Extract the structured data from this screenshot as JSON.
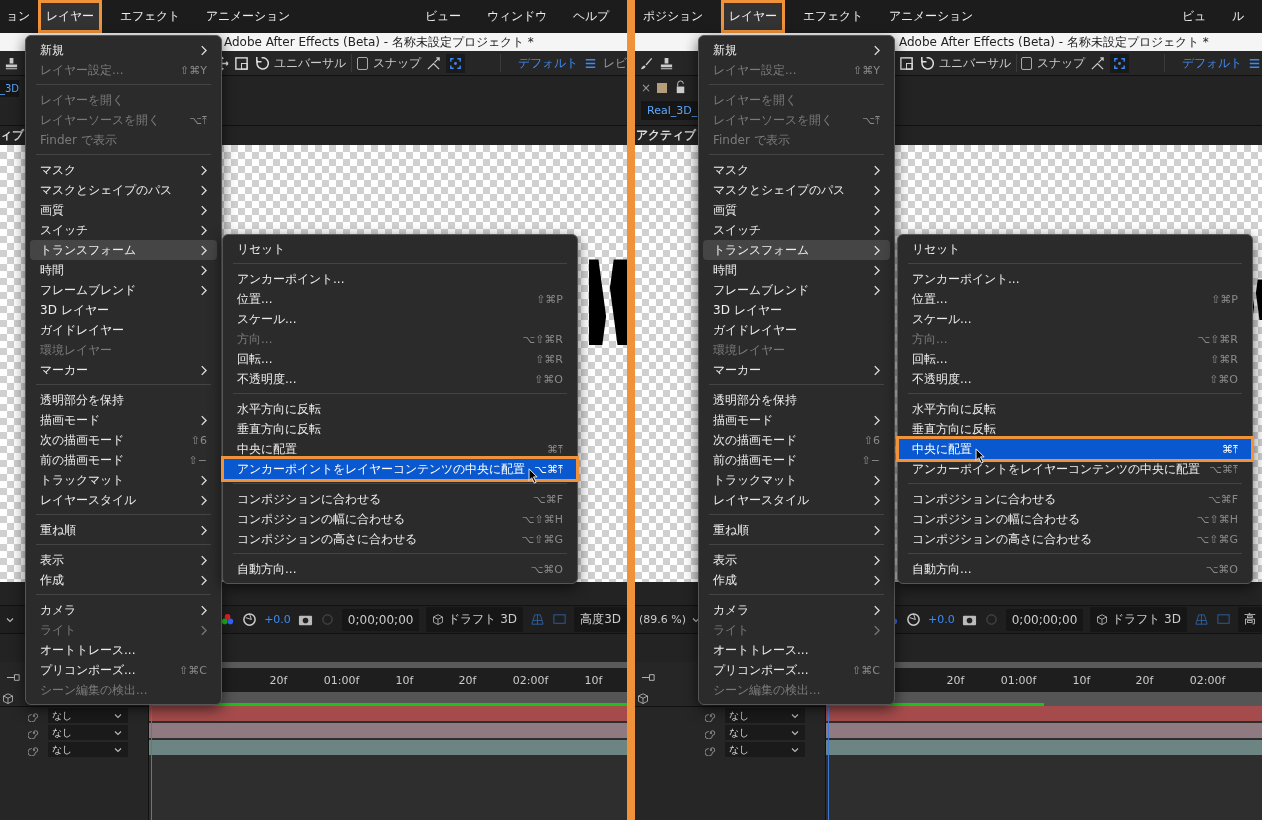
{
  "panels": [
    {
      "menubar": [
        {
          "label": "ョン",
          "selected": false
        },
        {
          "label": "レイヤー",
          "selected": true
        },
        {
          "label": "エフェクト",
          "selected": false
        },
        {
          "label": "アニメーション",
          "selected": false
        }
      ],
      "menubar_right": [
        {
          "label": "ビュー",
          "selected": false
        },
        {
          "label": "ウィンドウ",
          "selected": false
        },
        {
          "label": "ヘルプ",
          "selected": false
        }
      ],
      "title": "Adobe After Effects (Beta) - 名称未設定プロジェクト *",
      "toolbar": {
        "mode": "ユニバーサル",
        "snap": "スナップ",
        "snap_checked": false,
        "workspace": "デフォルト",
        "extra": "レビ"
      },
      "comp_tab": "_3D",
      "viewer_label": "ィブ",
      "viewer_bar": {
        "exposure": "+0.0",
        "timecode": "0;00;00;00",
        "renderer": "ドラフト 3D",
        "extra": "高度3D"
      },
      "ruler": [
        "20f",
        "01:00f",
        "10f",
        "20f",
        "02:00f",
        "10f"
      ],
      "work_area": {
        "level": 1
      },
      "layers": [
        {
          "parent": "なし",
          "color": "#a54b4b"
        },
        {
          "parent": "なし",
          "color": "#8e7a80"
        },
        {
          "parent": "なし",
          "color": "#6c8582"
        }
      ],
      "layer_menu": [
        {
          "kind": "item",
          "label": "新規",
          "submenu": true,
          "disabled": false,
          "selected": false
        },
        {
          "kind": "item",
          "label": "レイヤー設定...",
          "shortcut": "⇧⌘Y",
          "submenu": false,
          "disabled": true,
          "selected": false
        },
        {
          "kind": "separator"
        },
        {
          "kind": "item",
          "label": "レイヤーを開く",
          "submenu": false,
          "disabled": true,
          "selected": false
        },
        {
          "kind": "item",
          "label": "レイヤーソースを開く",
          "shortcut": "⌥⤒",
          "submenu": false,
          "disabled": true,
          "selected": false
        },
        {
          "kind": "item",
          "label": "Finder で表示",
          "submenu": false,
          "disabled": true,
          "selected": false
        },
        {
          "kind": "separator"
        },
        {
          "kind": "item",
          "label": "マスク",
          "submenu": true,
          "disabled": false,
          "selected": false
        },
        {
          "kind": "item",
          "label": "マスクとシェイプのパス",
          "submenu": true,
          "disabled": false,
          "selected": false
        },
        {
          "kind": "item",
          "label": "画質",
          "submenu": true,
          "disabled": false,
          "selected": false
        },
        {
          "kind": "item",
          "label": "スイッチ",
          "submenu": true,
          "disabled": false,
          "selected": false
        },
        {
          "kind": "item",
          "label": "トランスフォーム",
          "submenu": true,
          "disabled": false,
          "selected": true
        },
        {
          "kind": "item",
          "label": "時間",
          "submenu": true,
          "disabled": false,
          "selected": false
        },
        {
          "kind": "item",
          "label": "フレームブレンド",
          "submenu": true,
          "disabled": false,
          "selected": false
        },
        {
          "kind": "item",
          "label": "3D レイヤー",
          "submenu": false,
          "disabled": false,
          "selected": false
        },
        {
          "kind": "item",
          "label": "ガイドレイヤー",
          "submenu": false,
          "disabled": false,
          "selected": false
        },
        {
          "kind": "item",
          "label": "環境レイヤー",
          "submenu": false,
          "disabled": true,
          "selected": false
        },
        {
          "kind": "item",
          "label": "マーカー",
          "submenu": true,
          "disabled": false,
          "selected": false
        },
        {
          "kind": "separator"
        },
        {
          "kind": "item",
          "label": "透明部分を保持",
          "submenu": false,
          "disabled": false,
          "selected": false
        },
        {
          "kind": "item",
          "label": "描画モード",
          "submenu": true,
          "disabled": false,
          "selected": false
        },
        {
          "kind": "item",
          "label": "次の描画モード",
          "shortcut": "⇧6",
          "submenu": false,
          "disabled": false,
          "selected": false
        },
        {
          "kind": "item",
          "label": "前の描画モード",
          "shortcut": "⇧−",
          "submenu": false,
          "disabled": false,
          "selected": false
        },
        {
          "kind": "item",
          "label": "トラックマット",
          "submenu": true,
          "disabled": false,
          "selected": false
        },
        {
          "kind": "item",
          "label": "レイヤースタイル",
          "submenu": true,
          "disabled": false,
          "selected": false
        },
        {
          "kind": "separator"
        },
        {
          "kind": "item",
          "label": "重ね順",
          "submenu": true,
          "disabled": false,
          "selected": false
        },
        {
          "kind": "separator"
        },
        {
          "kind": "item",
          "label": "表示",
          "submenu": true,
          "disabled": false,
          "selected": false
        },
        {
          "kind": "item",
          "label": "作成",
          "submenu": true,
          "disabled": false,
          "selected": false
        },
        {
          "kind": "separator"
        },
        {
          "kind": "item",
          "label": "カメラ",
          "submenu": true,
          "disabled": false,
          "selected": false
        },
        {
          "kind": "item",
          "label": "ライト",
          "submenu": true,
          "disabled": true,
          "selected": false
        },
        {
          "kind": "item",
          "label": "オートトレース...",
          "submenu": false,
          "disabled": false,
          "selected": false
        },
        {
          "kind": "item",
          "label": "プリコンポーズ...",
          "shortcut": "⇧⌘C",
          "submenu": false,
          "disabled": false,
          "selected": false
        },
        {
          "kind": "item",
          "label": "シーン編集の検出...",
          "submenu": false,
          "disabled": true,
          "selected": false
        }
      ],
      "transform_menu": [
        {
          "kind": "item",
          "label": "リセット",
          "disabled": false,
          "selected": false,
          "hovered": false
        },
        {
          "kind": "separator"
        },
        {
          "kind": "item",
          "label": "アンカーポイント...",
          "disabled": false,
          "selected": false,
          "hovered": false
        },
        {
          "kind": "item",
          "label": "位置...",
          "shortcut": "⇧⌘P",
          "disabled": false,
          "selected": false,
          "hovered": false
        },
        {
          "kind": "item",
          "label": "スケール...",
          "disabled": false,
          "selected": false,
          "hovered": false
        },
        {
          "kind": "item",
          "label": "方向...",
          "shortcut": "⌥⇧⌘R",
          "disabled": true,
          "selected": false,
          "hovered": false
        },
        {
          "kind": "item",
          "label": "回転...",
          "shortcut": "⇧⌘R",
          "disabled": false,
          "selected": false,
          "hovered": false
        },
        {
          "kind": "item",
          "label": "不透明度...",
          "shortcut": "⇧⌘O",
          "disabled": false,
          "selected": false,
          "hovered": false
        },
        {
          "kind": "separator"
        },
        {
          "kind": "item",
          "label": "水平方向に反転",
          "disabled": false,
          "selected": false,
          "hovered": false
        },
        {
          "kind": "item",
          "label": "垂直方向に反転",
          "disabled": false,
          "selected": false,
          "hovered": false
        },
        {
          "kind": "item",
          "label": "中央に配置",
          "shortcut": "⌘⤒",
          "disabled": false,
          "selected": false,
          "hovered": false
        },
        {
          "kind": "item",
          "label": "アンカーポイントをレイヤーコンテンツの中央に配置",
          "shortcut": "⌥⌘⤒",
          "disabled": false,
          "selected": true,
          "hovered": true
        },
        {
          "kind": "separator"
        },
        {
          "kind": "item",
          "label": "コンポジションに合わせる",
          "shortcut": "⌥⌘F",
          "disabled": false,
          "selected": false,
          "hovered": false
        },
        {
          "kind": "item",
          "label": "コンポジションの幅に合わせる",
          "shortcut": "⌥⇧⌘H",
          "disabled": false,
          "selected": false,
          "hovered": false
        },
        {
          "kind": "item",
          "label": "コンポジションの高さに合わせる",
          "shortcut": "⌥⇧⌘G",
          "disabled": false,
          "selected": false,
          "hovered": false
        },
        {
          "kind": "separator"
        },
        {
          "kind": "item",
          "label": "自動方向...",
          "shortcut": "⌥⌘O",
          "disabled": false,
          "selected": false,
          "hovered": false
        }
      ]
    },
    {
      "menubar": [
        {
          "label": "ポジション",
          "selected": false
        },
        {
          "label": "レイヤー",
          "selected": true
        },
        {
          "label": "エフェクト",
          "selected": false
        },
        {
          "label": "アニメーション",
          "selected": false
        }
      ],
      "menubar_right": [
        {
          "label": "ビュ",
          "selected": false
        },
        {
          "label": "ル",
          "selected": false
        }
      ],
      "title": "Adobe After Effects (Beta) - 名称未設定プロジェクト *",
      "toolbar": {
        "mode": "ユニバーサル",
        "snap": "スナップ",
        "snap_checked": false,
        "workspace": "デフォルト"
      },
      "tab_close": "×",
      "comp_tab": "Real_3D_",
      "viewer_label": "アクティブ",
      "viewer_bar": {
        "zoom": "(89.6 %)",
        "exposure": "+0.0",
        "timecode": "0;00;00;00",
        "renderer": "ドラフト 3D",
        "extra": "高"
      },
      "ruler": [
        "20f",
        "01:00f",
        "10f",
        "20f",
        "02:00f"
      ],
      "work_area": {
        "level": 0.5
      },
      "layers": [
        {
          "parent": "なし",
          "color": "#a54b4b"
        },
        {
          "parent": "なし",
          "color": "#8e7a80"
        },
        {
          "parent": "なし",
          "color": "#6c8582"
        }
      ],
      "layer_menu": [
        {
          "kind": "item",
          "label": "新規",
          "submenu": true,
          "disabled": false,
          "selected": false
        },
        {
          "kind": "item",
          "label": "レイヤー設定...",
          "shortcut": "⇧⌘Y",
          "submenu": false,
          "disabled": true,
          "selected": false
        },
        {
          "kind": "separator"
        },
        {
          "kind": "item",
          "label": "レイヤーを開く",
          "submenu": false,
          "disabled": true,
          "selected": false
        },
        {
          "kind": "item",
          "label": "レイヤーソースを開く",
          "shortcut": "⌥⤒",
          "submenu": false,
          "disabled": true,
          "selected": false
        },
        {
          "kind": "item",
          "label": "Finder で表示",
          "submenu": false,
          "disabled": true,
          "selected": false
        },
        {
          "kind": "separator"
        },
        {
          "kind": "item",
          "label": "マスク",
          "submenu": true,
          "disabled": false,
          "selected": false
        },
        {
          "kind": "item",
          "label": "マスクとシェイプのパス",
          "submenu": true,
          "disabled": false,
          "selected": false
        },
        {
          "kind": "item",
          "label": "画質",
          "submenu": true,
          "disabled": false,
          "selected": false
        },
        {
          "kind": "item",
          "label": "スイッチ",
          "submenu": true,
          "disabled": false,
          "selected": false
        },
        {
          "kind": "item",
          "label": "トランスフォーム",
          "submenu": true,
          "disabled": false,
          "selected": true
        },
        {
          "kind": "item",
          "label": "時間",
          "submenu": true,
          "disabled": false,
          "selected": false
        },
        {
          "kind": "item",
          "label": "フレームブレンド",
          "submenu": true,
          "disabled": false,
          "selected": false
        },
        {
          "kind": "item",
          "label": "3D レイヤー",
          "submenu": false,
          "disabled": false,
          "selected": false
        },
        {
          "kind": "item",
          "label": "ガイドレイヤー",
          "submenu": false,
          "disabled": false,
          "selected": false
        },
        {
          "kind": "item",
          "label": "環境レイヤー",
          "submenu": false,
          "disabled": true,
          "selected": false
        },
        {
          "kind": "item",
          "label": "マーカー",
          "submenu": true,
          "disabled": false,
          "selected": false
        },
        {
          "kind": "separator"
        },
        {
          "kind": "item",
          "label": "透明部分を保持",
          "submenu": false,
          "disabled": false,
          "selected": false
        },
        {
          "kind": "item",
          "label": "描画モード",
          "submenu": true,
          "disabled": false,
          "selected": false
        },
        {
          "kind": "item",
          "label": "次の描画モード",
          "shortcut": "⇧6",
          "submenu": false,
          "disabled": false,
          "selected": false
        },
        {
          "kind": "item",
          "label": "前の描画モード",
          "shortcut": "⇧−",
          "submenu": false,
          "disabled": false,
          "selected": false
        },
        {
          "kind": "item",
          "label": "トラックマット",
          "submenu": true,
          "disabled": false,
          "selected": false
        },
        {
          "kind": "item",
          "label": "レイヤースタイル",
          "submenu": true,
          "disabled": false,
          "selected": false
        },
        {
          "kind": "separator"
        },
        {
          "kind": "item",
          "label": "重ね順",
          "submenu": true,
          "disabled": false,
          "selected": false
        },
        {
          "kind": "separator"
        },
        {
          "kind": "item",
          "label": "表示",
          "submenu": true,
          "disabled": false,
          "selected": false
        },
        {
          "kind": "item",
          "label": "作成",
          "submenu": true,
          "disabled": false,
          "selected": false
        },
        {
          "kind": "separator"
        },
        {
          "kind": "item",
          "label": "カメラ",
          "submenu": true,
          "disabled": false,
          "selected": false
        },
        {
          "kind": "item",
          "label": "ライト",
          "submenu": true,
          "disabled": true,
          "selected": false
        },
        {
          "kind": "item",
          "label": "オートトレース...",
          "submenu": false,
          "disabled": false,
          "selected": false
        },
        {
          "kind": "item",
          "label": "プリコンポーズ...",
          "shortcut": "⇧⌘C",
          "submenu": false,
          "disabled": false,
          "selected": false
        },
        {
          "kind": "item",
          "label": "シーン編集の検出...",
          "submenu": false,
          "disabled": true,
          "selected": false
        }
      ],
      "transform_menu": [
        {
          "kind": "item",
          "label": "リセット",
          "disabled": false,
          "selected": false,
          "hovered": false
        },
        {
          "kind": "separator"
        },
        {
          "kind": "item",
          "label": "アンカーポイント...",
          "disabled": false,
          "selected": false,
          "hovered": false
        },
        {
          "kind": "item",
          "label": "位置...",
          "shortcut": "⇧⌘P",
          "disabled": false,
          "selected": false,
          "hovered": false
        },
        {
          "kind": "item",
          "label": "スケール...",
          "disabled": false,
          "selected": false,
          "hovered": false
        },
        {
          "kind": "item",
          "label": "方向...",
          "shortcut": "⌥⇧⌘R",
          "disabled": true,
          "selected": false,
          "hovered": false
        },
        {
          "kind": "item",
          "label": "回転...",
          "shortcut": "⇧⌘R",
          "disabled": false,
          "selected": false,
          "hovered": false
        },
        {
          "kind": "item",
          "label": "不透明度...",
          "shortcut": "⇧⌘O",
          "disabled": false,
          "selected": false,
          "hovered": false
        },
        {
          "kind": "separator"
        },
        {
          "kind": "item",
          "label": "水平方向に反転",
          "disabled": false,
          "selected": false,
          "hovered": false
        },
        {
          "kind": "item",
          "label": "垂直方向に反転",
          "disabled": false,
          "selected": false,
          "hovered": false
        },
        {
          "kind": "item",
          "label": "中央に配置",
          "shortcut": "⌘⤒",
          "disabled": false,
          "selected": true,
          "hovered": true
        },
        {
          "kind": "item",
          "label": "アンカーポイントをレイヤーコンテンツの中央に配置",
          "shortcut": "⌥⌘⤒",
          "disabled": false,
          "selected": false,
          "hovered": false
        },
        {
          "kind": "separator"
        },
        {
          "kind": "item",
          "label": "コンポジションに合わせる",
          "shortcut": "⌥⌘F",
          "disabled": false,
          "selected": false,
          "hovered": false
        },
        {
          "kind": "item",
          "label": "コンポジションの幅に合わせる",
          "shortcut": "⌥⇧⌘H",
          "disabled": false,
          "selected": false,
          "hovered": false
        },
        {
          "kind": "item",
          "label": "コンポジションの高さに合わせる",
          "shortcut": "⌥⇧⌘G",
          "disabled": false,
          "selected": false,
          "hovered": false
        },
        {
          "kind": "separator"
        },
        {
          "kind": "item",
          "label": "自動方向...",
          "shortcut": "⌥⌘O",
          "disabled": false,
          "selected": false,
          "hovered": false
        }
      ]
    }
  ]
}
